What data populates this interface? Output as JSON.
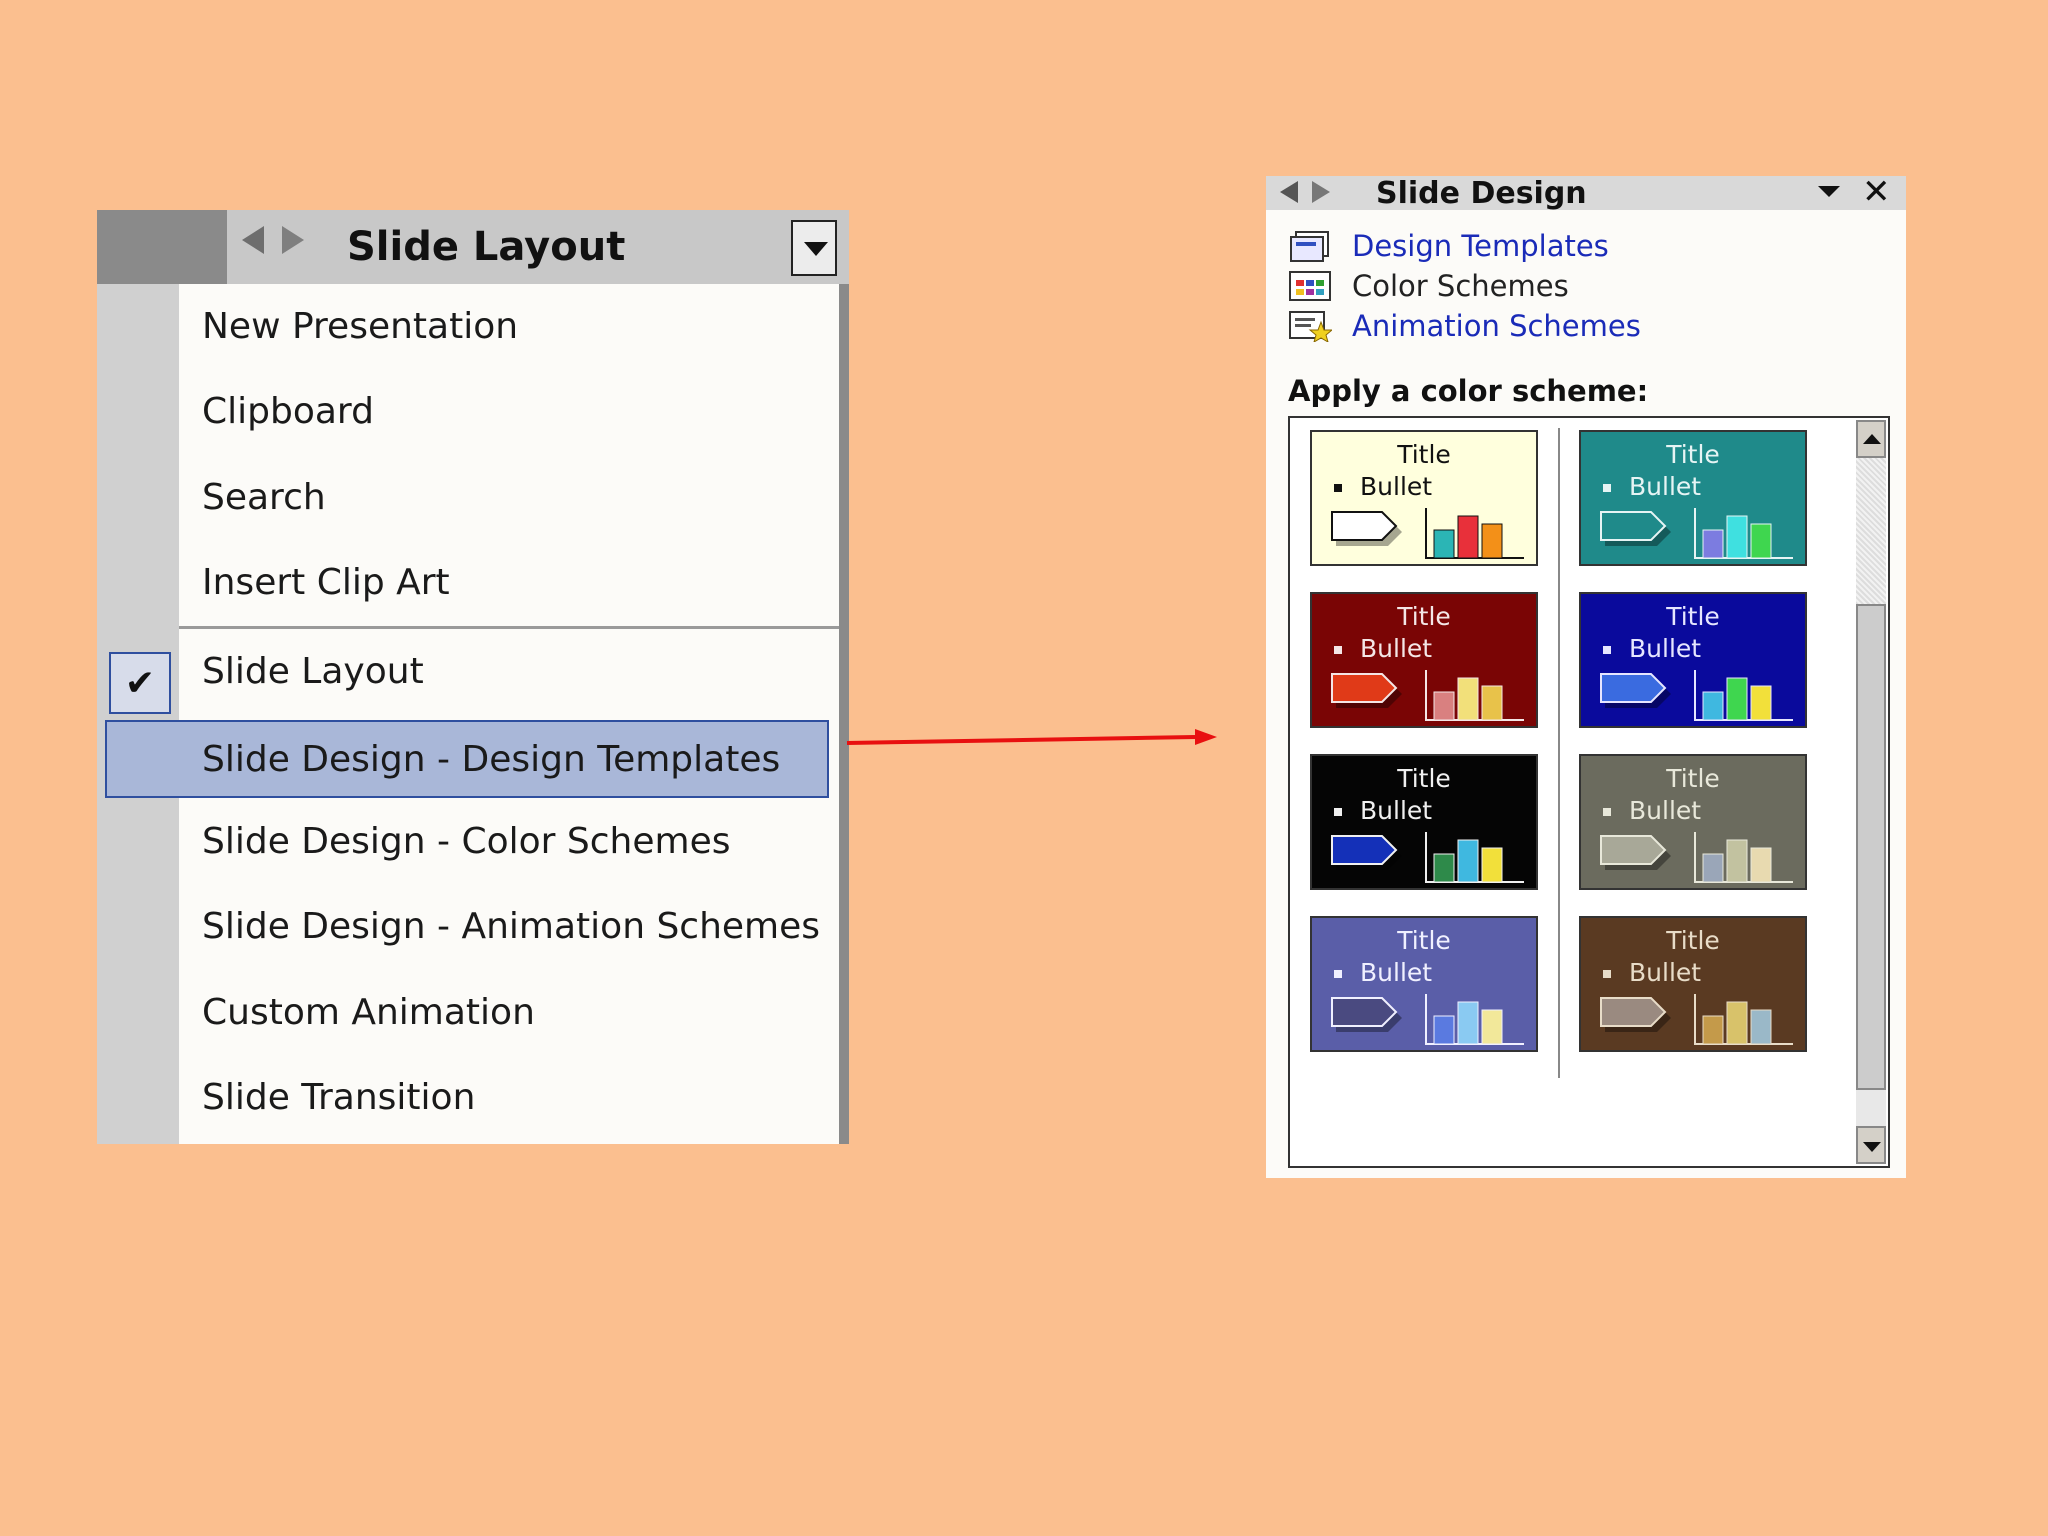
{
  "left_panel": {
    "title": "Slide Layout",
    "items": [
      {
        "label": "New Presentation"
      },
      {
        "label": "Clipboard"
      },
      {
        "label": "Search"
      },
      {
        "label": "Insert Clip Art"
      },
      {
        "label": "Slide Layout",
        "checked": true
      },
      {
        "label": "Slide Design - Design Templates",
        "selected": true
      },
      {
        "label": "Slide Design - Color Schemes"
      },
      {
        "label": "Slide Design - Animation Schemes"
      },
      {
        "label": "Custom Animation"
      },
      {
        "label": "Slide Transition"
      }
    ],
    "check_glyph": "✔"
  },
  "right_panel": {
    "title": "Slide Design",
    "close_glyph": "✕",
    "links": [
      {
        "label": "Design Templates",
        "icon": "design-templates-icon",
        "active": true
      },
      {
        "label": "Color Schemes",
        "icon": "color-schemes-icon",
        "active": false
      },
      {
        "label": "Animation Schemes",
        "icon": "animation-schemes-icon",
        "active": true
      }
    ],
    "apply_label": "Apply a color scheme:",
    "schemes": [
      {
        "title": "Title",
        "bullet": "Bullet",
        "bg": "#FFFFDD",
        "text": "#111111",
        "shape": "#FFFFFF",
        "bars": [
          "#2BB5B5",
          "#E8303A",
          "#F39018"
        ]
      },
      {
        "title": "Title",
        "bullet": "Bullet",
        "bg": "#1F8A8A",
        "text": "#E6F4F4",
        "shape": "#1F8A8A",
        "bars": [
          "#7C7CE0",
          "#3FE0E0",
          "#3FD64F"
        ]
      },
      {
        "title": "Title",
        "bullet": "Bullet",
        "bg": "#7A0505",
        "text": "#F4E6E6",
        "shape": "#E03A18",
        "bars": [
          "#D98080",
          "#F2E07A",
          "#E8C24A"
        ]
      },
      {
        "title": "Title",
        "bullet": "Bullet",
        "bg": "#0A0A9C",
        "text": "#E6E6FF",
        "shape": "#3A6BE0",
        "bars": [
          "#3FB8E0",
          "#3FD64F",
          "#F2E03A"
        ]
      },
      {
        "title": "Title",
        "bullet": "Bullet",
        "bg": "#050505",
        "text": "#F0F0F0",
        "shape": "#1430B8",
        "bars": [
          "#2E8A4A",
          "#3FB8E0",
          "#F2E03A"
        ]
      },
      {
        "title": "Title",
        "bullet": "Bullet",
        "bg": "#6B6B5E",
        "text": "#E8E8DA",
        "shape": "#A8A898",
        "bars": [
          "#9AA6B8",
          "#C2C2A0",
          "#E8DAB0"
        ]
      },
      {
        "title": "Title",
        "bullet": "Bullet",
        "bg": "#5A5EA8",
        "text": "#F0F0FF",
        "shape": "#4A4A80",
        "bars": [
          "#5A7AE0",
          "#8ACAF2",
          "#F2E89A"
        ]
      },
      {
        "title": "Title",
        "bullet": "Bullet",
        "bg": "#5A3A22",
        "text": "#E8DCC8",
        "shape": "#9A8A80",
        "bars": [
          "#C49A4A",
          "#D8C26A",
          "#9AB8C8"
        ]
      }
    ]
  },
  "colors": {
    "background": "#FBBF8F",
    "arrow": "#E81010",
    "selection": "#A9B7D8",
    "link": "#1A2BB8"
  }
}
